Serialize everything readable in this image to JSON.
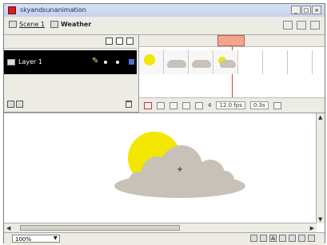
{
  "window": {
    "title": "skyandsunanimation"
  },
  "scenebar": {
    "scene_label": "Scene 1",
    "symbol_label": "Weather"
  },
  "timeline": {
    "layer_name": "Layer 1",
    "current_frame": "4",
    "frame_rate": "12.0 fps",
    "elapsed": "0.3s"
  },
  "statusbar": {
    "zoom": "100%"
  },
  "colors": {
    "sun": "#f3e600",
    "cloud": "#c7c1b8",
    "layer_selected": "#000000",
    "playhead": "#e0402a"
  },
  "icons": {
    "scene": "clapper-icon",
    "symbol": "graphic-symbol-icon",
    "eye": "eye-icon",
    "lock": "lock-icon",
    "outline": "outline-square-icon",
    "pencil": "pencil-icon",
    "trash": "trash-icon"
  }
}
